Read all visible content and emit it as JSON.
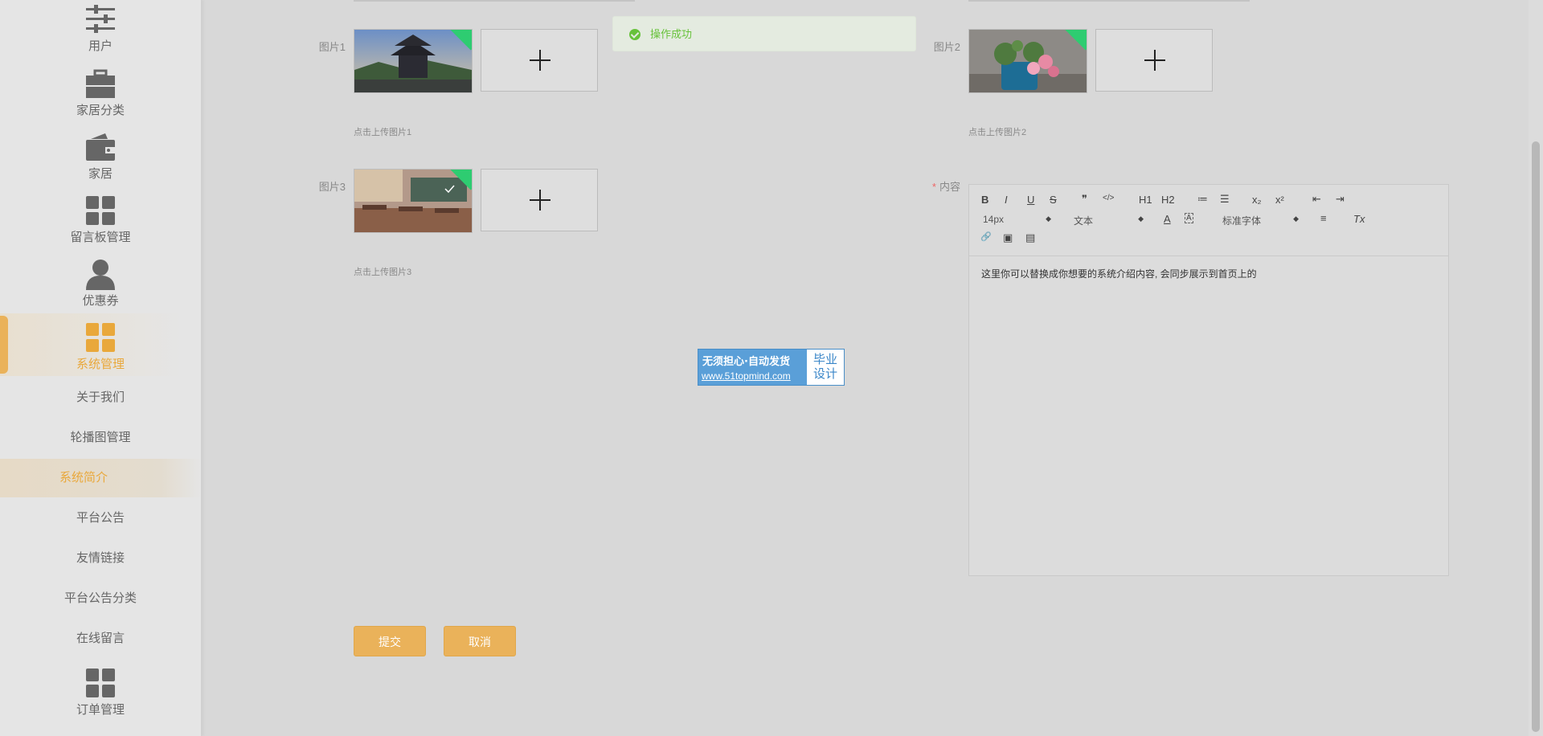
{
  "sidebar": {
    "items": [
      {
        "label": "用户",
        "icon": "sliders-icon"
      },
      {
        "label": "家居分类",
        "icon": "briefcase-icon"
      },
      {
        "label": "家居",
        "icon": "wallet-icon"
      },
      {
        "label": "留言板管理",
        "icon": "grid-icon"
      },
      {
        "label": "优惠券",
        "icon": "user-icon"
      },
      {
        "label": "系统管理",
        "icon": "grid-icon"
      }
    ],
    "sub_items": [
      "关于我们",
      "轮播图管理",
      "系统简介",
      "平台公告",
      "友情链接",
      "平台公告分类",
      "在线留言"
    ],
    "bottom_item": {
      "label": "订单管理",
      "icon": "grid-icon"
    },
    "active_color": "#e9a83b"
  },
  "toast": {
    "message": "操作成功"
  },
  "form": {
    "image1": {
      "label": "图片1",
      "hint": "点击上传图片1"
    },
    "image2": {
      "label": "图片2",
      "hint": "点击上传图片2"
    },
    "image3": {
      "label": "图片3",
      "hint": "点击上传图片3"
    },
    "content": {
      "label": "内容",
      "required_mark": "*",
      "toolbar": {
        "bold": "B",
        "italic": "I",
        "underline": "U",
        "strike": "S",
        "quote": "❞",
        "code": "</>",
        "h1": "H1",
        "h2": "H2",
        "ordered_list": "≔",
        "bullet_list": "☰",
        "sub": "x₂",
        "sup": "x²",
        "outdent": "⇤",
        "indent": "⇥",
        "size": "14px",
        "header": "文本",
        "font": "标准字体",
        "color": "A",
        "background": "A",
        "align": "≡",
        "clean": "Tx",
        "link": "🔗",
        "image": "▣",
        "video": "▤"
      },
      "value": "这里你可以替换成你想要的系统介绍内容, 会同步展示到首页上的"
    },
    "submit_label": "提交",
    "cancel_label": "取消"
  },
  "watermark": {
    "line1": "无须担心·自动发货",
    "line2": "www.51topmind.com",
    "box": "毕业\n设计"
  }
}
